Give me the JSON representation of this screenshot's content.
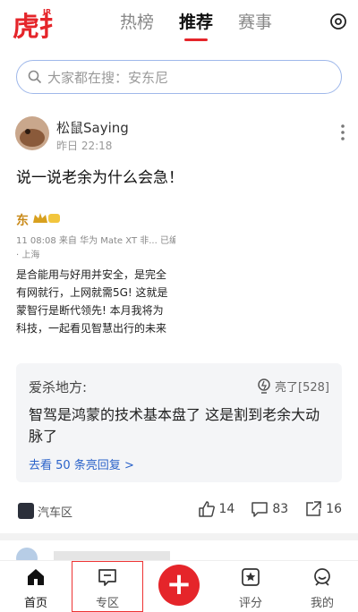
{
  "logo": {
    "text": "虎扑",
    "badge": "JR"
  },
  "tabs": [
    {
      "label": "热榜",
      "active": false
    },
    {
      "label": "推荐",
      "active": true
    },
    {
      "label": "赛事",
      "active": false
    }
  ],
  "search": {
    "placeholder": "大家都在搜：安东尼"
  },
  "post": {
    "username": "松鼠Saying",
    "time": "昨日 22:18",
    "title": "说一说老余为什么会急！",
    "image_lines": [
      "东",
      "11 08:08  来自 华为 Mate XT 非...  已编",
      "· 上海",
      "是合能用与好用并安全，是完全",
      "有网就行，上网就需5G! 这就是",
      "蒙智行是断代领先! 本月我将为",
      "科技，一起看见智慧出行的未来"
    ],
    "hot_reply": {
      "author": "爱杀地方:",
      "light_label": "亮了[528]",
      "text": "智驾是鸿蒙的技术基本盘了 这是割到老余大动脉了",
      "more": "去看 50 条亮回复 >"
    },
    "tag": "汽车区",
    "likes": "14",
    "comments": "83",
    "shares": "16"
  },
  "bottom_nav": [
    {
      "label": "首页",
      "icon": "home-icon"
    },
    {
      "label": "专区",
      "icon": "zone-icon"
    },
    {
      "label": "",
      "icon": "plus-icon"
    },
    {
      "label": "评分",
      "icon": "rating-icon"
    },
    {
      "label": "我的",
      "icon": "profile-icon"
    }
  ],
  "colors": {
    "accent": "#e5252a",
    "link": "#2a62c9",
    "search_border": "#9fb8ea"
  }
}
